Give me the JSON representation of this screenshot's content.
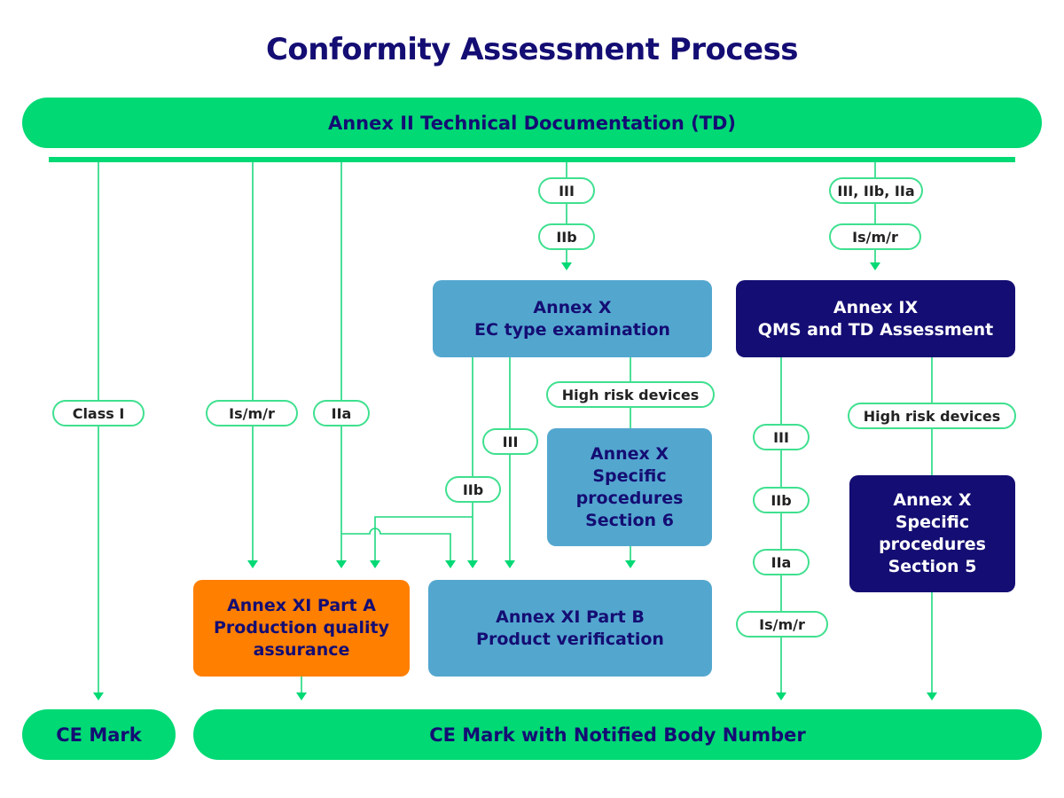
{
  "title": "Conformity Assessment Process",
  "colors": {
    "green": "#00d974",
    "line_green": "#1fd97f",
    "navy": "#140d73",
    "light_blue": "#53a7cf",
    "orange": "#ff7f00"
  },
  "top_bar": {
    "label": "Annex II Technical Documentation (TD)"
  },
  "boxes": {
    "annex_x_ec": {
      "label": "Annex X\nEC type examination"
    },
    "annex_ix": {
      "label": "Annex IX\nQMS and TD Assessment"
    },
    "annex_x_s6": {
      "label": "Annex X\nSpecific\nprocedures\nSection 6"
    },
    "annex_x_s5": {
      "label": "Annex X\nSpecific\nprocedures\nSection 5"
    },
    "annex_xi_a": {
      "label": "Annex XI Part A\nProduction quality\nassurance"
    },
    "annex_xi_b": {
      "label": "Annex XI Part B\nProduct verification"
    }
  },
  "pills": {
    "ec_iii": "III",
    "ec_iib": "IIb",
    "ix_classes": "III, IIb, IIa",
    "ix_ismr": "Is/m/r",
    "class_i": "Class I",
    "left_ismr": "Is/m/r",
    "left_iia": "IIa",
    "high_risk_mid": "High risk devices",
    "x_iii": "III",
    "x_iib": "IIb",
    "high_risk_right": "High risk devices",
    "ix_iii": "III",
    "ix_iib": "IIb",
    "ix_iia": "IIa",
    "ix_ismr_low": "Is/m/r"
  },
  "bottom": {
    "ce_mark": "CE Mark",
    "ce_mark_nb": "CE Mark with Notified Body Number"
  }
}
